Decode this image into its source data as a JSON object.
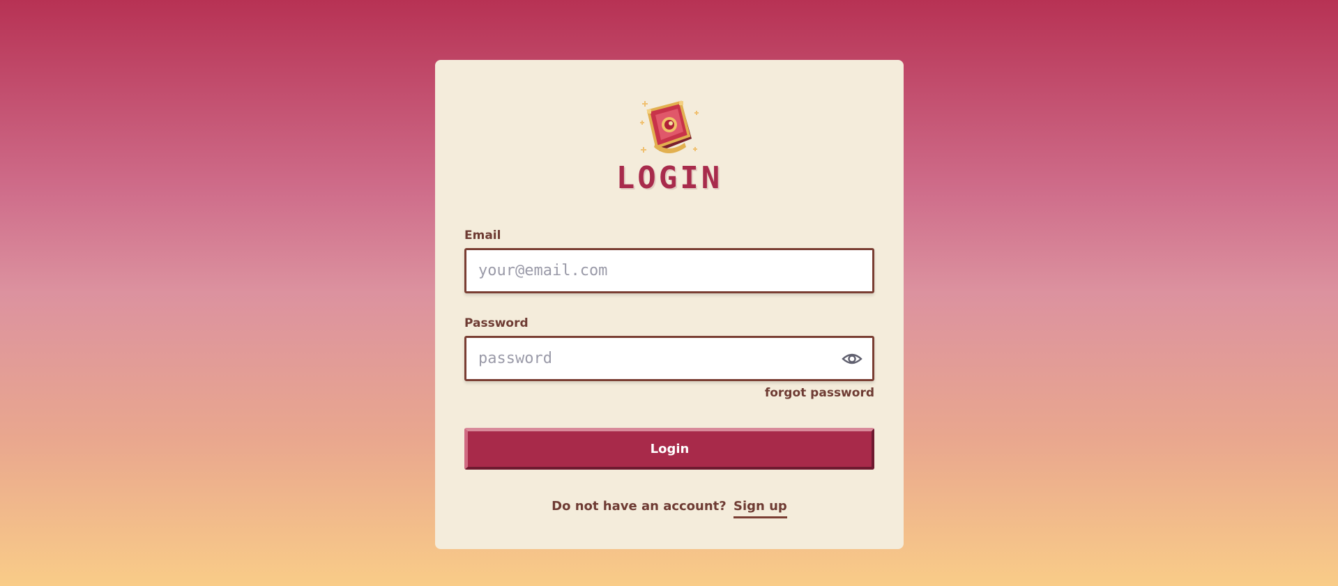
{
  "page": {
    "title": "LOGIN",
    "logo_icon": "spellbook-icon"
  },
  "form": {
    "email": {
      "label": "Email",
      "placeholder": "your@email.com",
      "value": ""
    },
    "password": {
      "label": "Password",
      "placeholder": "password",
      "value": "",
      "toggle_icon": "eye-icon"
    },
    "forgot_label": "forgot password",
    "submit_label": "Login"
  },
  "signup": {
    "prompt": "Do not have an account?",
    "link_label": "Sign up"
  },
  "colors": {
    "accent": "#a82a4a",
    "card_bg": "#f4ecdb",
    "text_brown": "#6e3b33",
    "gradient_top": "#b73254",
    "gradient_bottom": "#f9cc88"
  }
}
